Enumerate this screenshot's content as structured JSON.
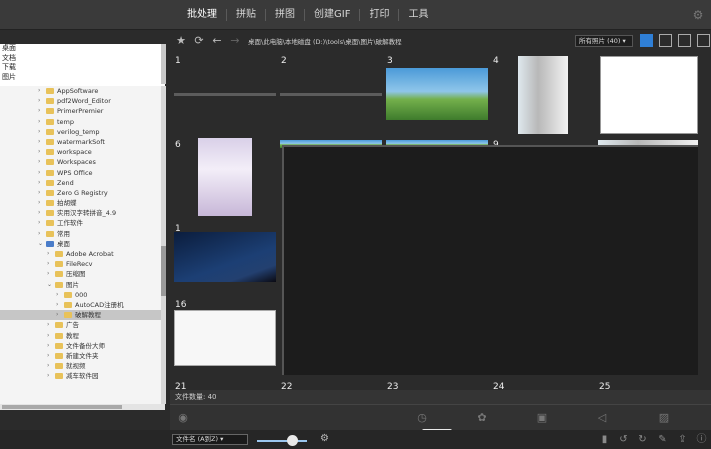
{
  "menu": {
    "items": [
      {
        "label": "批处理",
        "active": true
      },
      {
        "label": "拼贴",
        "active": false
      },
      {
        "label": "拼图",
        "active": false
      },
      {
        "label": "创建GIF",
        "active": false
      },
      {
        "label": "打印",
        "active": false
      },
      {
        "label": "工具",
        "active": false
      }
    ]
  },
  "shortcuts": [
    "桌面",
    "文档",
    "下载",
    "图片"
  ],
  "tree": [
    {
      "label": "AppSoftware",
      "indent": 1
    },
    {
      "label": "pdf2Word_Editor",
      "indent": 1
    },
    {
      "label": "PrimerPremier",
      "indent": 1
    },
    {
      "label": "temp",
      "indent": 1
    },
    {
      "label": "verilog_temp",
      "indent": 1
    },
    {
      "label": "watermarkSoft",
      "indent": 1
    },
    {
      "label": "workspace",
      "indent": 1
    },
    {
      "label": "Workspaces",
      "indent": 1
    },
    {
      "label": "WPS Office",
      "indent": 1
    },
    {
      "label": "Zend",
      "indent": 1
    },
    {
      "label": "Zero G Registry",
      "indent": 1
    },
    {
      "label": "拍胡蝶",
      "indent": 1
    },
    {
      "label": "实用汉字转拼音_4.9",
      "indent": 1
    },
    {
      "label": "工作软件",
      "indent": 1
    },
    {
      "label": "常用",
      "indent": 1
    },
    {
      "label": "桌面",
      "indent": 1,
      "expanded": true,
      "blue": true
    },
    {
      "label": "Adobe Acrobat",
      "indent": 2
    },
    {
      "label": "FileRecv",
      "indent": 2
    },
    {
      "label": "压缩图",
      "indent": 2
    },
    {
      "label": "图片",
      "indent": 2,
      "expanded": true
    },
    {
      "label": "000",
      "indent": 3
    },
    {
      "label": "AutoCAD注册机",
      "indent": 3
    },
    {
      "label": "破解教程",
      "indent": 3,
      "selected": true
    },
    {
      "label": "广告",
      "indent": 2
    },
    {
      "label": "教程",
      "indent": 2
    },
    {
      "label": "文件备份大师",
      "indent": 2
    },
    {
      "label": "新建文件夹",
      "indent": 2
    },
    {
      "label": "就视频",
      "indent": 2
    },
    {
      "label": "减车软件园",
      "indent": 2
    }
  ],
  "toolbar": {
    "path": "桌面\\此电脑\\本地磁盘 (D:)\\tools\\桌面\\图片\\破解教程",
    "filter": "所有照片 (40)",
    "icons": [
      "star-icon",
      "refresh-icon",
      "back-icon",
      "forward-icon"
    ]
  },
  "thumbnails": {
    "row1": [
      "1",
      "2",
      "3",
      "4",
      ""
    ],
    "row2": [
      "6",
      "",
      "",
      "9",
      ""
    ],
    "row3": [
      "1",
      "1",
      "",
      "",
      ""
    ],
    "row4": [
      "16",
      "",
      "",
      "",
      ""
    ],
    "row5": [
      "21",
      "22",
      "23",
      "24",
      "25"
    ]
  },
  "status": {
    "label": "文件数量",
    "count": "40"
  },
  "footer": {
    "sort": "文件名 (A到Z)",
    "zoom_value": 0.7
  },
  "colors": {
    "accent": "#2f7fd6",
    "panel": "#2b2b2b",
    "menubar": "#3a3a3a"
  }
}
